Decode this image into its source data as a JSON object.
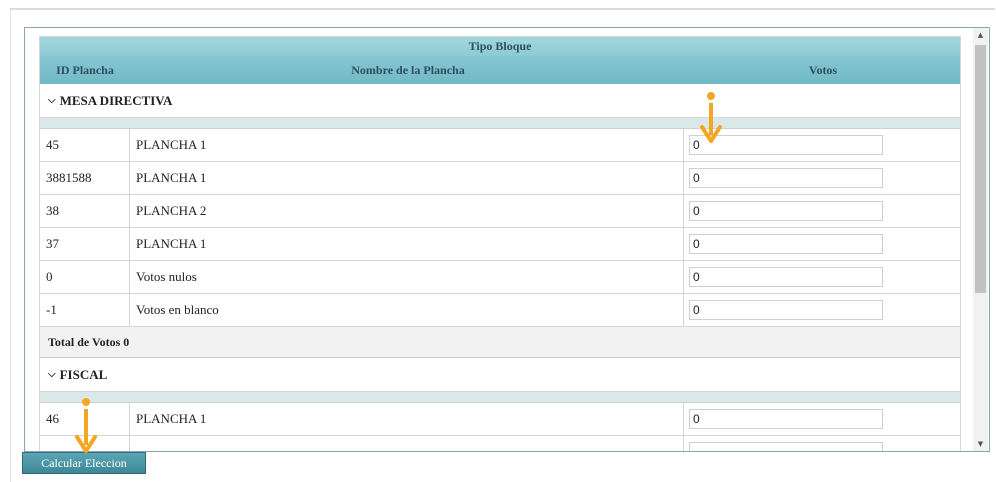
{
  "table": {
    "title": "Tipo Bloque",
    "columns": [
      "ID Plancha",
      "Nombre de la Plancha",
      "Votos"
    ]
  },
  "sections": [
    {
      "name": "MESA DIRECTIVA",
      "rows": [
        {
          "id": "45",
          "name": "PLANCHA 1",
          "votes": "0"
        },
        {
          "id": "3881588",
          "name": "PLANCHA 1",
          "votes": "0"
        },
        {
          "id": "38",
          "name": "PLANCHA 2",
          "votes": "0"
        },
        {
          "id": "37",
          "name": "PLANCHA 1",
          "votes": "0"
        },
        {
          "id": "0",
          "name": "Votos nulos",
          "votes": "0"
        },
        {
          "id": "-1",
          "name": "Votos en blanco",
          "votes": "0"
        }
      ],
      "total": "Total de Votos 0"
    },
    {
      "name": "FISCAL",
      "rows": [
        {
          "id": "46",
          "name": "PLANCHA 1",
          "votes": "0"
        }
      ]
    }
  ],
  "button": {
    "label": "Calcular Eleccion"
  },
  "colors": {
    "header": "#8ccad4",
    "button": "#4a95a5",
    "arrow": "#f5a623"
  }
}
